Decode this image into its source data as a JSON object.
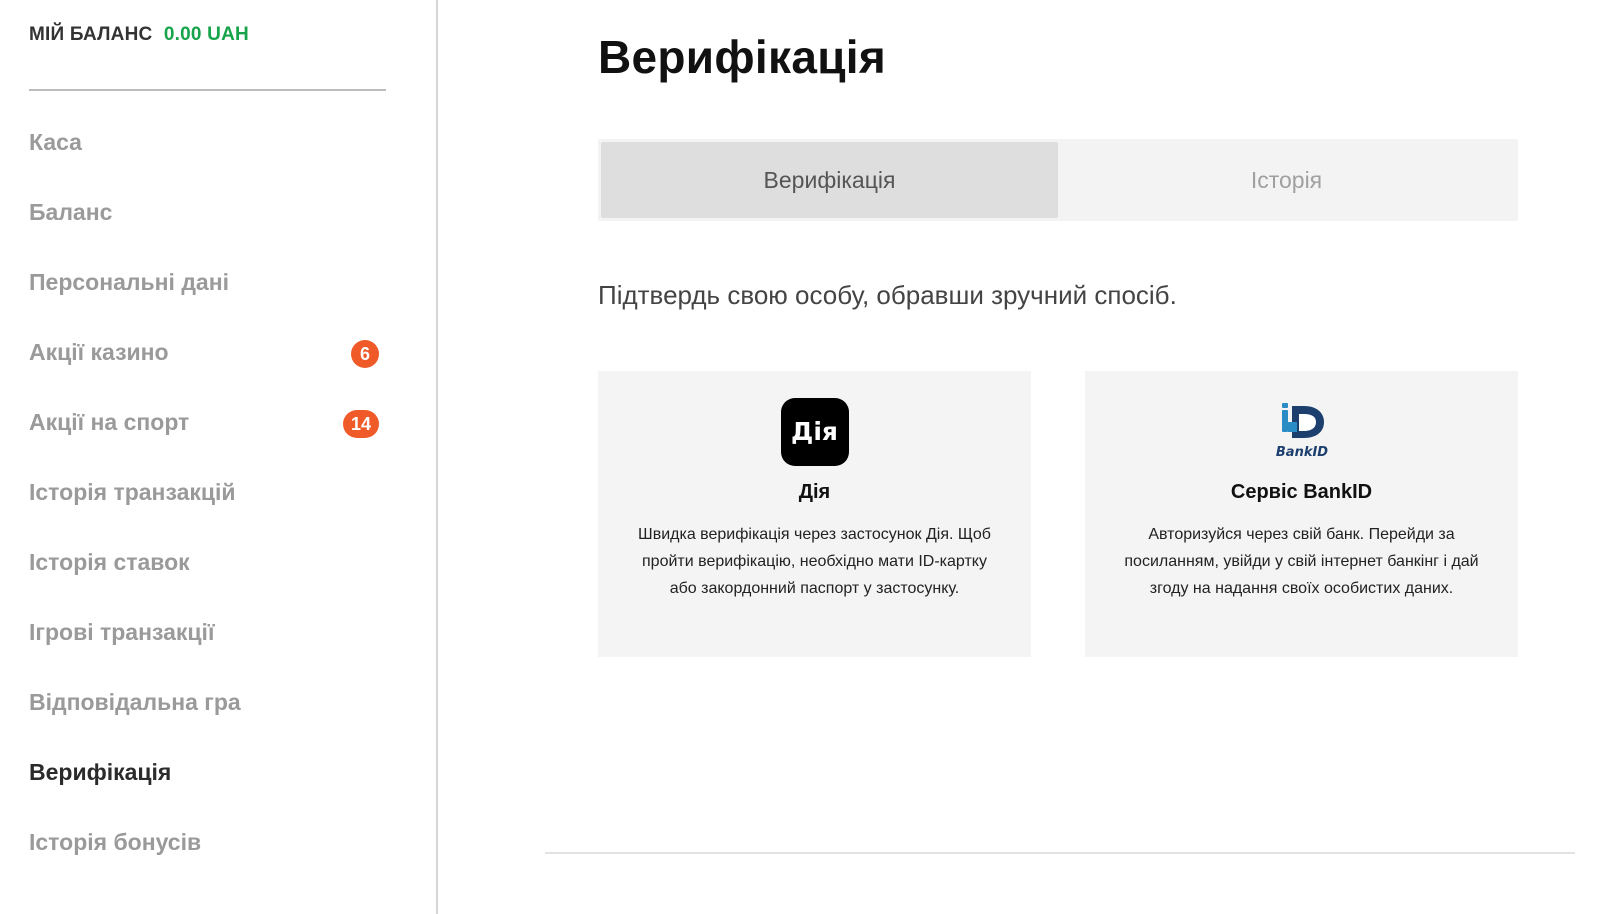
{
  "balance": {
    "label": "МІЙ БАЛАНС",
    "amount": "0.00 UAH",
    "amount_color": "#16a34a"
  },
  "sidebar": {
    "items": [
      {
        "label": "Каса"
      },
      {
        "label": "Баланс"
      },
      {
        "label": "Персональні дані"
      },
      {
        "label": "Акції казино",
        "badge": "6"
      },
      {
        "label": "Акції на спорт",
        "badge": "14"
      },
      {
        "label": "Історія транзакцій"
      },
      {
        "label": "Історія ставок"
      },
      {
        "label": "Ігрові транзакції"
      },
      {
        "label": "Відповідальна гра"
      },
      {
        "label": "Верифікація",
        "active": true
      },
      {
        "label": "Історія бонусів"
      }
    ],
    "badge_color": "#f05a28"
  },
  "main": {
    "title": "Верифікація",
    "tabs": [
      {
        "label": "Верифікація",
        "active": true
      },
      {
        "label": "Історія"
      }
    ],
    "subtitle": "Підтвердь свою особу, обравши зручний спосіб.",
    "cards": [
      {
        "logo_text": "Дія",
        "logo_icon": "diia-logo-icon",
        "title": "Дія",
        "text": "Швидка верифікація через застосунок Дія. Щоб пройти верифікацію, необхідно мати ID-картку або закордонний паспорт у застосунку."
      },
      {
        "logo_text": "BankID",
        "logo_icon": "bankid-logo-icon",
        "title": "Сервіс BankID",
        "text": "Авторизуйся через свій банк. Перейди за посиланням, увійди у свій інтернет банкінг і дай згоду на надання своїх особистих даних."
      }
    ]
  }
}
